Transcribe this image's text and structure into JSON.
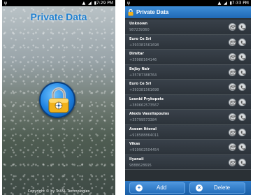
{
  "left_screen": {
    "status": {
      "time": "7:29 PM",
      "icons": "▲ ◢ ▮"
    },
    "title": "Private Data",
    "lock_icon": "padlock-icon",
    "copyright": "Copyright © by ToXSL Technologies"
  },
  "right_screen": {
    "status": {
      "time": "7:33 PM",
      "icons": "▲ ◢ ▮"
    },
    "title": "Private Data",
    "contacts": [
      {
        "name": "Unknown",
        "number": "987239360"
      },
      {
        "name": "Euro Ce Sri",
        "number": "+393381561698"
      },
      {
        "name": "Dimitar",
        "number": "+35988164146"
      },
      {
        "name": "Bejby Nair",
        "number": "+35787388764"
      },
      {
        "name": "Euro Ce Sri",
        "number": "+393381561698"
      },
      {
        "name": "Leonid Prykopets",
        "number": "+380662573567"
      },
      {
        "name": "Alexis Vassilopoulos",
        "number": "+35799573384"
      },
      {
        "name": "Aseem Ittoval",
        "number": "+918588864011"
      },
      {
        "name": "Vikas",
        "number": "+919902504454"
      },
      {
        "name": "Ilyanaii",
        "number": "9888628695"
      }
    ],
    "add_label": "Add",
    "delete_label": "Delete"
  },
  "colors": {
    "title_blue": "#1e7fd0",
    "bar_blue": "#1f68b4",
    "list_bg": "#2c333a"
  }
}
